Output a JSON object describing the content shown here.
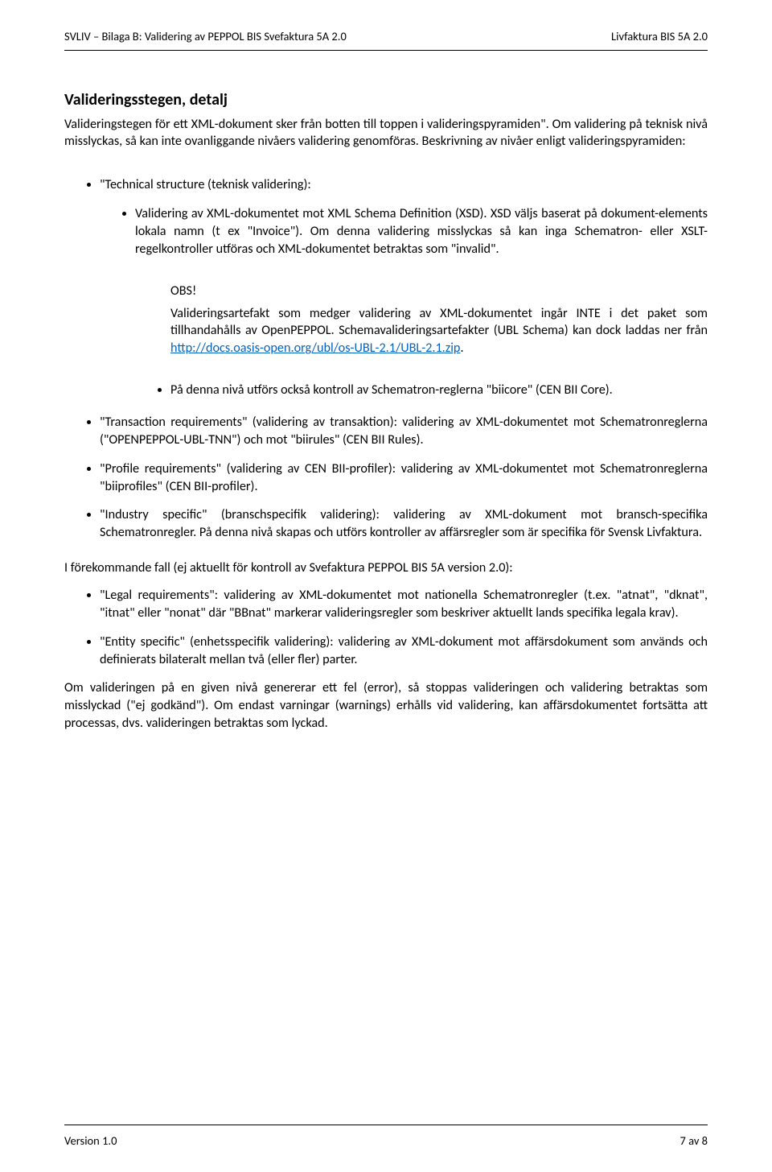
{
  "header": {
    "left": "SVLIV – Bilaga B: Validering av PEPPOL BIS Svefaktura 5A 2.0",
    "right": "Livfaktura BIS 5A 2.0"
  },
  "title": "Valideringsstegen, detalj",
  "intro": "Valideringstegen för ett XML-dokument sker från botten till toppen i valideringspyramiden\". Om validering på teknisk nivå misslyckas, så kan inte ovanliggande nivåers validering genomföras. Beskrivning av nivåer enligt valideringspyramiden:",
  "tech_label": "\"Technical structure (teknisk validering):",
  "tech_detail": "Validering av XML-dokumentet mot XML Schema Definition (XSD). XSD väljs baserat på dokument-elements lokala namn (t ex \"Invoice\"). Om denna validering misslyckas så kan inga Schematron- eller XSLT-regelkontroller utföras och XML-dokumentet betraktas som \"invalid\".",
  "obs_label": "OBS!",
  "obs_text_before": "Valideringsartefakt som medger validering av XML-dokumentet ingår INTE i det paket som tillhandahålls av OpenPEPPOL. Schemavalideringsartefakter (UBL Schema) kan dock laddas ner från ",
  "obs_link": "http://docs.oasis-open.org/ubl/os-UBL-2.1/UBL-2.1.zip",
  "obs_text_after": ".",
  "after_obs": "På denna nivå utförs också kontroll av Schematron-reglerna \"biicore\" (CEN BII Core).",
  "outer_items": [
    "\"Transaction requirements\" (validering av transaktion): validering av XML-dokumentet mot Schematronreglerna (\"OPENPEPPOL-UBL-TNN\") och mot \"biirules\" (CEN BII Rules).",
    "\"Profile requirements\" (validering av CEN BII-profiler): validering av XML-dokumentet mot Schematronreglerna \"biiprofiles\" (CEN BII-profiler).",
    "\"Industry specific\" (branschspecifik validering): validering av XML-dokument mot bransch-specifika Schematronregler. På denna nivå skapas och utförs kontroller av affärsregler som är specifika för Svensk Livfaktura."
  ],
  "standalone": "I förekommande fall (ej aktuellt för kontroll av Svefaktura PEPPOL BIS 5A version 2.0):",
  "secondary_items": [
    "\"Legal requirements\": validering av XML-dokumentet mot nationella Schematronregler (t.ex. \"atnat\", \"dknat\", \"itnat\" eller \"nonat\" där \"BBnat\" markerar valideringsregler som beskriver aktuellt lands specifika legala krav).",
    "\"Entity specific\" (enhetsspecifik validering): validering av XML-dokument mot affärsdokument som används och definierats bilateralt mellan två (eller fler) parter."
  ],
  "tail": "Om valideringen på en given nivå genererar ett fel (error), så stoppas valideringen och validering betraktas som misslyckad (\"ej godkänd\"). Om endast varningar (warnings) erhålls vid validering, kan affärsdokumentet fortsätta att processas, dvs. valideringen betraktas som lyckad.",
  "footer": {
    "left": "Version 1.0",
    "right": "7 av 8"
  }
}
